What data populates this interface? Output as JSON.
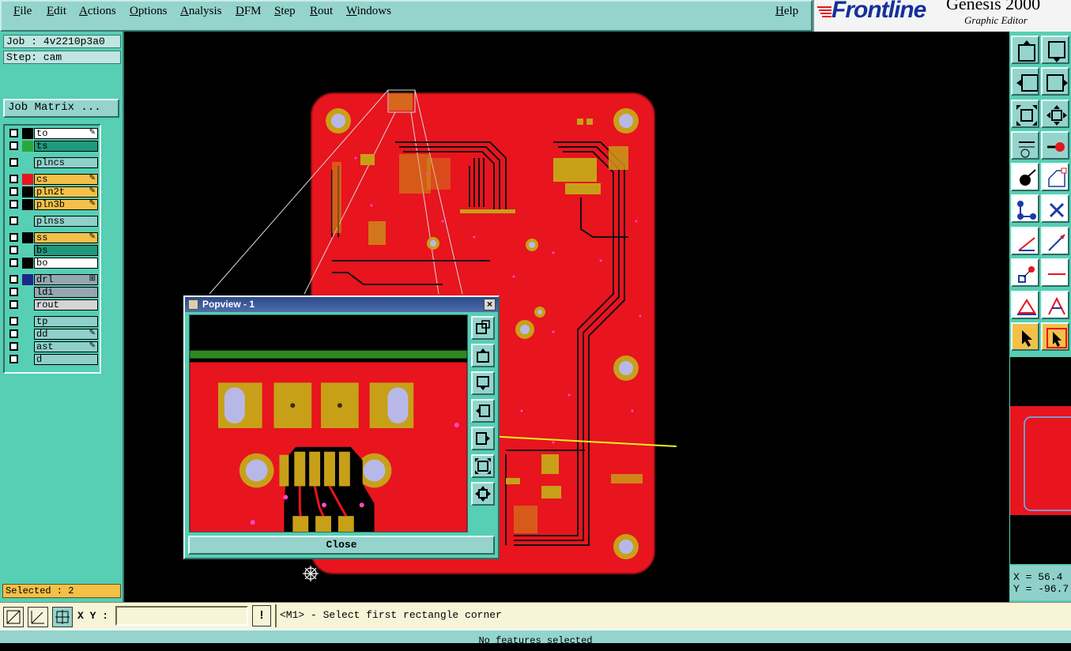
{
  "menu": [
    "File",
    "Edit",
    "Actions",
    "Options",
    "Analysis",
    "DFM",
    "Step",
    "Rout",
    "Windows"
  ],
  "help": "Help",
  "logo": {
    "brand": "Frontline",
    "product": "Genesis 2000",
    "subtitle": "Graphic Editor"
  },
  "job": "Job : 4v2210p3a0",
  "step": "Step: cam",
  "job_matrix": "Job Matrix ...",
  "layers": [
    {
      "name": "to",
      "bg": "#ffffff",
      "sel": "#000000",
      "flag": "✎"
    },
    {
      "name": "ts",
      "bg": "#1f9a7c",
      "sel": "#2ba83c",
      "flag": ""
    },
    {
      "name": "plncs",
      "bg": "#8fd0ca",
      "sel": "#56cfb4",
      "flag": ""
    },
    {
      "name": "cs",
      "bg": "#f3c048",
      "sel": "#e8141e",
      "flag": "✎"
    },
    {
      "name": "pln2t",
      "bg": "#f3c048",
      "sel": "#000000",
      "flag": "✎"
    },
    {
      "name": "pln3b",
      "bg": "#f3c048",
      "sel": "#000000",
      "flag": "✎"
    },
    {
      "name": "plnss",
      "bg": "#8fd0ca",
      "sel": "#56cfb4",
      "flag": ""
    },
    {
      "name": "ss",
      "bg": "#f3c048",
      "sel": "#000000",
      "flag": "✎"
    },
    {
      "name": "bs",
      "bg": "#1f9a7c",
      "sel": "#56cfb4",
      "flag": ""
    },
    {
      "name": "bo",
      "bg": "#ffffff",
      "sel": "#000000",
      "flag": ""
    },
    {
      "name": "drl",
      "bg": "#94a8b0",
      "sel": "#1a2a8a",
      "flag": "⊞"
    },
    {
      "name": "ldi",
      "bg": "#94a8b0",
      "sel": "#56cfb4",
      "flag": ""
    },
    {
      "name": "rout",
      "bg": "#d4d4d4",
      "sel": "#56cfb4",
      "flag": ""
    },
    {
      "name": "tp",
      "bg": "#8fd0ca",
      "sel": "#56cfb4",
      "flag": ""
    },
    {
      "name": "dd",
      "bg": "#8fd0ca",
      "sel": "#56cfb4",
      "flag": "✎"
    },
    {
      "name": "ast",
      "bg": "#8fd0ca",
      "sel": "#56cfb4",
      "flag": "✎"
    },
    {
      "name": "d",
      "bg": "#8fd0ca",
      "sel": "#56cfb4",
      "flag": ""
    }
  ],
  "selected": "Selected : 2",
  "coords": "X = 56.4\nY = -96.7",
  "xy_label": "X Y :",
  "prompt": "<M1> - Select first rectangle corner",
  "status": "No features selected",
  "popview": {
    "title": "Popview - 1",
    "close": "Close"
  },
  "toolbar_icons": [
    "zoom-fit-icon",
    "zoom-home-icon",
    "pan-left-icon",
    "pan-right-icon",
    "zoom-all-icon",
    "zoom-window-icon",
    "measure-icon",
    "probe-icon",
    "select-icon",
    "snap-icon",
    "net-icon",
    "cross-icon",
    "line-icon",
    "arrow-line-icon",
    "connect-icon",
    "minus-icon",
    "triangle-icon",
    "triangle-select-icon",
    "pointer-icon",
    "pointer-box-icon"
  ],
  "colors": {
    "accent": "#56cfb4",
    "board": "#e8141e",
    "copper": "#c8a018",
    "highlight": "#f3c048"
  }
}
